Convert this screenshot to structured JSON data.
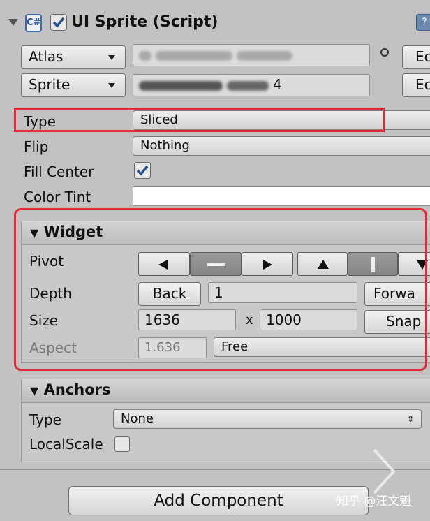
{
  "component": {
    "title": "UI Sprite (Script)",
    "script_icon": "csharp-script-icon",
    "enabled": true
  },
  "sprite": {
    "atlas_label": "Atlas",
    "sprite_label": "Sprite",
    "sprite_value_suffix": "4",
    "atlas_edit_label": "Ec",
    "sprite_edit_label": "Ec",
    "type_label": "Type",
    "type_value": "Sliced",
    "flip_label": "Flip",
    "flip_value": "Nothing",
    "fill_center_label": "Fill Center",
    "fill_center_checked": true,
    "color_tint_label": "Color Tint",
    "color_tint_value": "#ffffff"
  },
  "widget": {
    "header": "Widget",
    "pivot_label": "Pivot",
    "depth_label": "Depth",
    "back_label": "Back",
    "depth_value": "1",
    "forward_label": "Forwa",
    "size_label": "Size",
    "width": "1636",
    "x_sep": "x",
    "height": "1000",
    "snap_label": "Snap",
    "aspect_label": "Aspect",
    "aspect_value": "1.636",
    "aspect_mode": "Free"
  },
  "anchors": {
    "header": "Anchors",
    "type_label": "Type",
    "type_value": "None",
    "localscale_label": "LocalScale",
    "localscale_checked": false
  },
  "footer": {
    "add_component": "Add Component",
    "watermark": "知乎 @汪文魁"
  },
  "colors": {
    "highlight": "#e02a3a",
    "panel_bg": "#c2c2c2",
    "check_blue": "#2b4f8a"
  }
}
